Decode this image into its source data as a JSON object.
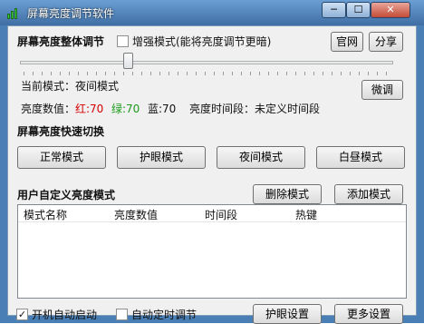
{
  "window": {
    "title": "屏幕亮度调节软件",
    "min": "─",
    "max": "☐",
    "close": "✕"
  },
  "overall": {
    "heading": "屏幕亮度整体调节",
    "enhance_label": "增强模式(能将亮度调节更暗)",
    "enhance_checked": false,
    "website_button": "官网",
    "share_button": "分享"
  },
  "slider": {
    "value_fraction": 0.29
  },
  "current": {
    "mode_label": "当前模式：夜间模式",
    "fine_tune_button": "微调"
  },
  "brightness": {
    "label": "亮度数值：",
    "red": "红:70",
    "green": "绿:70",
    "blue": "蓝:70",
    "period": "亮度时间段：未定义时间段"
  },
  "quick": {
    "heading": "屏幕亮度快速切换",
    "buttons": [
      "正常模式",
      "护眼模式",
      "夜间模式",
      "白昼模式"
    ]
  },
  "custom": {
    "heading": "用户自定义亮度模式",
    "delete_button": "删除模式",
    "add_button": "添加模式",
    "columns": [
      "模式名称",
      "亮度数值",
      "时间段",
      "热键"
    ]
  },
  "footer": {
    "autostart_label": "开机自动启动",
    "autostart_checked": true,
    "timed_label": "自动定时调节",
    "timed_checked": false,
    "eye_settings_button": "护眼设置",
    "more_settings_button": "更多设置"
  },
  "colors": {
    "red": "#d40000",
    "green": "#1a9a1a",
    "title_bar": "#4a7fb6"
  }
}
